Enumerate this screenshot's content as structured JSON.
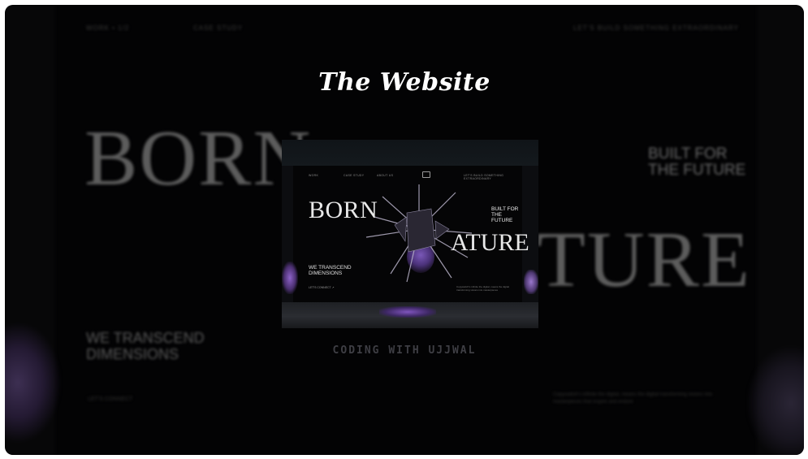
{
  "title": "The Website",
  "watermark": "CODING WITH UJJWAL",
  "background": {
    "nav_left": "WORK • 1/2",
    "nav_case": "CASE STUDY",
    "nav_right": "LET'S BUILD SOMETHING EXTRAORDINARY",
    "big_left": "BORN",
    "big_right": "TURE",
    "built_line1": "BUILT FOR",
    "built_line2": "THE FUTURE",
    "transcend_line1": "WE TRANSCEND",
    "transcend_line2": "DIMENSIONS",
    "contact": "LET'S CONNECT",
    "paragraph": "Copyswitch's infinite the digital, means the digital transforming visions into masterpieces that inspire and endure"
  },
  "thumbnail": {
    "nav_items": [
      "WORK",
      "CASE STUDY",
      "ABOUT US",
      "LET'S BUILD SOMETHING EXTRAORDINARY"
    ],
    "born": "BORN",
    "ature": "ATURE",
    "built_line1": "BUILT FOR",
    "built_line2": "THE FUTURE",
    "transcend_line1": "WE TRANSCEND",
    "transcend_line2": "DIMENSIONS",
    "contact": "LET'S CONNECT  ↗",
    "description": "Copyswitch's infinite the digital, means the digital transforming visions into masterpieces"
  },
  "colors": {
    "frame_bg": "#030304",
    "accent_purple": "#7a58b8",
    "title_text": "#ffffff"
  }
}
